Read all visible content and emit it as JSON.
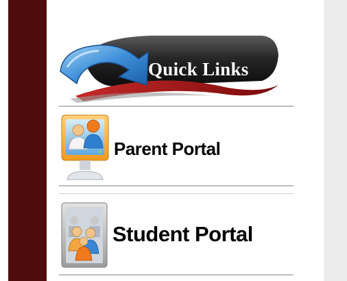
{
  "banner": {
    "label": "Quick Links",
    "icon": "arrow-icon"
  },
  "links": [
    {
      "label": "Parent Portal",
      "icon": "parent-monitor-icon"
    },
    {
      "label": "Student Portal",
      "icon": "student-group-icon"
    }
  ],
  "colors": {
    "sidebar": "#4e0c0c",
    "side_panel": "#ececec",
    "banner_dark": "#1f1f1f",
    "arrow_blue": "#3d8fd8",
    "accent_red": "#a3141c"
  }
}
